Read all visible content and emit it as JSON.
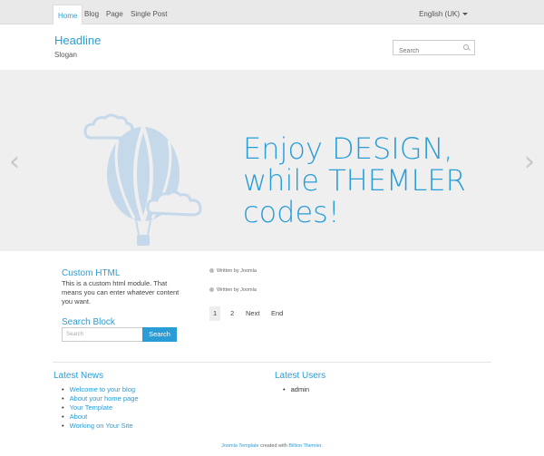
{
  "nav": {
    "items": [
      {
        "label": "Home",
        "active": true
      },
      {
        "label": "Blog"
      },
      {
        "label": "Page"
      },
      {
        "label": "Single Post"
      }
    ],
    "language": "English (UK)"
  },
  "header": {
    "headline": "Headline",
    "slogan": "Slogan",
    "search_placeholder": "Search"
  },
  "slider": {
    "line1": "Enjoy DESIGN,",
    "line2": "while THEMLER",
    "line3": "codes!",
    "prev_icon": "chevron-left-icon",
    "next_icon": "chevron-right-icon"
  },
  "custom_html": {
    "title": "Custom HTML",
    "text": "This is a custom html module. That means you can enter whatever content you want."
  },
  "search_block": {
    "title": "Search Block",
    "placeholder": "Search",
    "button": "Search"
  },
  "posts": {
    "written_1": "Written by Joomla",
    "written_2": "Written by Joomla"
  },
  "pagination": {
    "p1": "1",
    "p2": "2",
    "next": "Next",
    "end": "End"
  },
  "latest_news": {
    "title": "Latest News",
    "items": [
      "Welcome to your blog",
      "About your home page",
      "Your Template",
      "About",
      "Working on Your Site"
    ]
  },
  "latest_users": {
    "title": "Latest Users",
    "items": [
      "admin"
    ]
  },
  "footer": {
    "link1": "Joomla Template",
    "middle": " created with ",
    "link2": "Billion Themler",
    "end": "."
  },
  "colors": {
    "accent": "#2a9dd6",
    "slider_bg": "#efefef",
    "balloon": "#c5d9ea"
  }
}
